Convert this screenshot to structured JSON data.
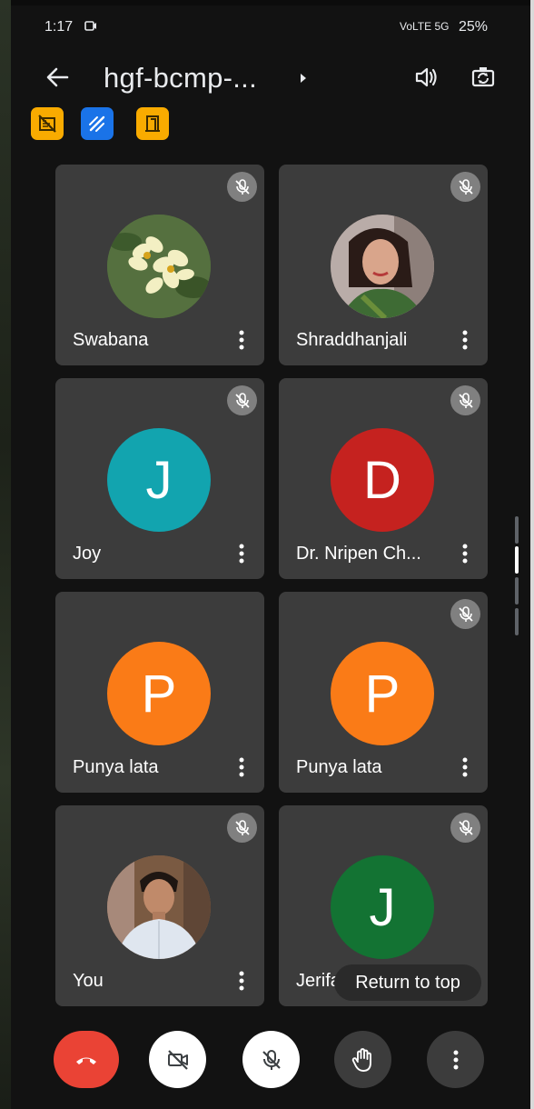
{
  "status_bar": {
    "time": "1:17",
    "network": "VoLTE 5G",
    "battery": "25%"
  },
  "header": {
    "title": "hgf-bcmp-...",
    "icons": [
      "back-arrow-icon",
      "speaker-icon",
      "camera-flip-icon"
    ]
  },
  "badges": [
    {
      "icon": "no-recording-icon",
      "color": "#f9ab00"
    },
    {
      "icon": "whiteboard-pen-icon",
      "color": "#1a73e8"
    },
    {
      "icon": "door-icon",
      "color": "#f9ab00"
    }
  ],
  "participants": [
    {
      "name": "Swabana",
      "avatar": "photo-flowers",
      "muted": true
    },
    {
      "name": "Shraddhanjali",
      "avatar": "photo-woman",
      "muted": true
    },
    {
      "name": "Joy",
      "initial": "J",
      "color": "#12a4af",
      "muted": true
    },
    {
      "name": "Dr. Nripen Ch...",
      "initial": "D",
      "color": "#c5221f",
      "muted": true
    },
    {
      "name": "Punya lata",
      "initial": "P",
      "color": "#fa7b17",
      "muted": false
    },
    {
      "name": "Punya lata",
      "initial": "P",
      "color": "#fa7b17",
      "muted": true
    },
    {
      "name": "You",
      "avatar": "photo-man",
      "muted": true
    },
    {
      "name": "Jerifa",
      "initial": "J",
      "color": "#137333",
      "muted": true
    }
  ],
  "return_to_top": "Return to top",
  "controls": {
    "end_call_color": "#ea4335",
    "icons": [
      "end-call-icon",
      "camera-off-icon",
      "mic-off-icon",
      "raise-hand-icon",
      "more-options-icon"
    ]
  }
}
